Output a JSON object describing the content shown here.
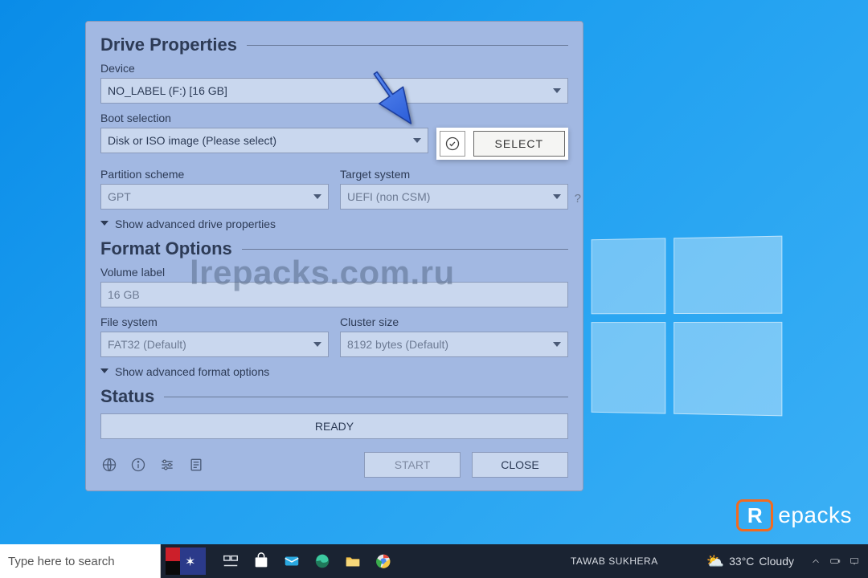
{
  "drive_props": {
    "title": "Drive Properties",
    "device_label": "Device",
    "device_value": "NO_LABEL (F:) [16 GB]",
    "boot_label": "Boot selection",
    "boot_value": "Disk or ISO image (Please select)",
    "select_btn": "SELECT",
    "partition_label": "Partition scheme",
    "partition_value": "GPT",
    "target_label": "Target system",
    "target_value": "UEFI (non CSM)",
    "advanced_drive": "Show advanced drive properties"
  },
  "format_opts": {
    "title": "Format Options",
    "volume_label_label": "Volume label",
    "volume_label_value": "16 GB",
    "fs_label": "File system",
    "fs_value": "FAT32 (Default)",
    "cluster_label": "Cluster size",
    "cluster_value": "8192 bytes (Default)",
    "advanced_format": "Show advanced format options"
  },
  "status": {
    "title": "Status",
    "value": "READY",
    "start": "START",
    "close": "CLOSE"
  },
  "watermark": "lrepacks.com.ru",
  "repacks": {
    "letter": "R",
    "rest": "epacks"
  },
  "taskbar": {
    "search_placeholder": "Type here to search",
    "user": "TAWAB SUKHERA",
    "weather_temp": "33°C",
    "weather_cond": "Cloudy"
  }
}
